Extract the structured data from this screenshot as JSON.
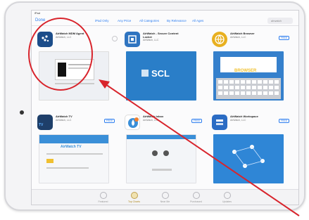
{
  "status": {
    "left": "iPad",
    "time": "",
    "right": ""
  },
  "nav": {
    "back": "Done",
    "filters": [
      "iPad Only",
      "Any Price",
      "All Categories",
      "By Relevance",
      "All Ages"
    ],
    "search": "airwatch"
  },
  "apps": [
    {
      "name": "AirWatch MDM Agent",
      "sub": "AirWatch, LLC",
      "rating": "",
      "button": "",
      "icon_color": "#1c4d8a"
    },
    {
      "name": "AirWatch - Secure Content Locker",
      "sub": "AirWatch, LLC",
      "rating": "",
      "button": "",
      "icon_color": "#2f74c0"
    },
    {
      "name": "AirWatch Browser",
      "sub": "AirWatch, LLC",
      "rating": "",
      "button": "FREE",
      "icon_color": "#e8b020"
    },
    {
      "name": "AirWatch TV",
      "sub": "AirWatch, LLC",
      "rating": "",
      "button": "FREE",
      "icon_color": "#1e3f6a"
    },
    {
      "name": "AirWatch Inbox",
      "sub": "AirWatch, LLC",
      "rating": "",
      "button": "FREE",
      "icon_color": "#3a8fd8"
    },
    {
      "name": "AirWatch Workspace",
      "sub": "AirWatch, LLC",
      "rating": "",
      "button": "FREE",
      "icon_color": "#2b6cc4"
    }
  ],
  "previews": {
    "scl_logo": "SCL",
    "browser_logo": "BROWSER",
    "tv_logo": "AirWatch TV"
  },
  "tabs": [
    "Featured",
    "Top Charts",
    "Near Me",
    "Purchased",
    "Updates"
  ],
  "active_tab": 1,
  "annotation_color": "#d8242c"
}
